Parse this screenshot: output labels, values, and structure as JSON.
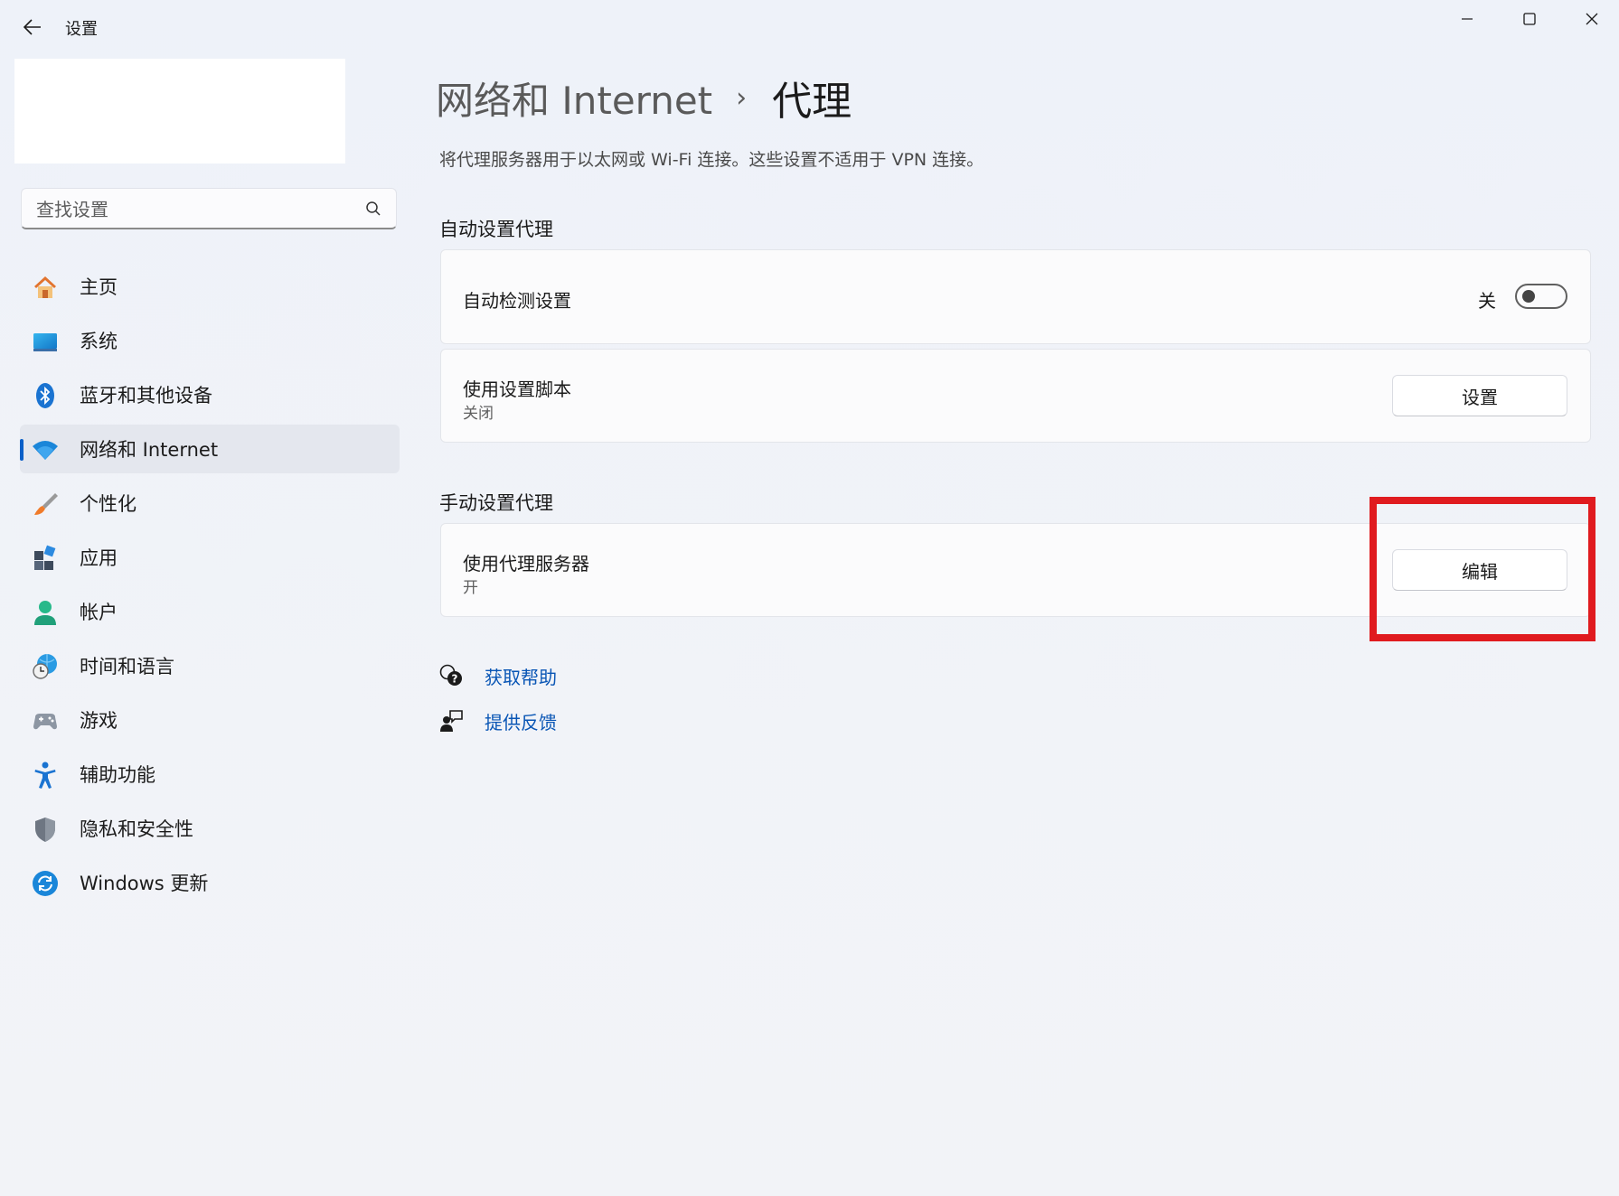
{
  "window": {
    "title": "设置"
  },
  "search": {
    "placeholder": "查找设置"
  },
  "sidebar": {
    "items": [
      {
        "label": "主页",
        "icon": "home-icon"
      },
      {
        "label": "系统",
        "icon": "system-icon"
      },
      {
        "label": "蓝牙和其他设备",
        "icon": "bluetooth-icon"
      },
      {
        "label": "网络和 Internet",
        "icon": "wifi-icon",
        "active": true
      },
      {
        "label": "个性化",
        "icon": "brush-icon"
      },
      {
        "label": "应用",
        "icon": "apps-icon"
      },
      {
        "label": "帐户",
        "icon": "account-icon"
      },
      {
        "label": "时间和语言",
        "icon": "globe-clock-icon"
      },
      {
        "label": "游戏",
        "icon": "gamepad-icon"
      },
      {
        "label": "辅助功能",
        "icon": "accessibility-icon"
      },
      {
        "label": "隐私和安全性",
        "icon": "shield-icon"
      },
      {
        "label": "Windows 更新",
        "icon": "update-icon"
      }
    ]
  },
  "header": {
    "parent": "网络和 Internet",
    "separator": "›",
    "current": "代理"
  },
  "description": "将代理服务器用于以太网或 Wi-Fi 连接。这些设置不适用于 VPN 连接。",
  "auto_proxy": {
    "section_title": "自动设置代理",
    "auto_detect": {
      "title": "自动检测设置",
      "toggle_label": "关",
      "toggle_on": false
    },
    "script": {
      "title": "使用设置脚本",
      "status": "关闭",
      "button_label": "设置"
    }
  },
  "manual_proxy": {
    "section_title": "手动设置代理",
    "proxy_server": {
      "title": "使用代理服务器",
      "status": "开",
      "button_label": "编辑"
    }
  },
  "links": {
    "help": "获取帮助",
    "feedback": "提供反馈"
  },
  "colors": {
    "accent": "#0a5fc8",
    "link": "#0a56b5",
    "highlight_box": "#e01b1f"
  }
}
